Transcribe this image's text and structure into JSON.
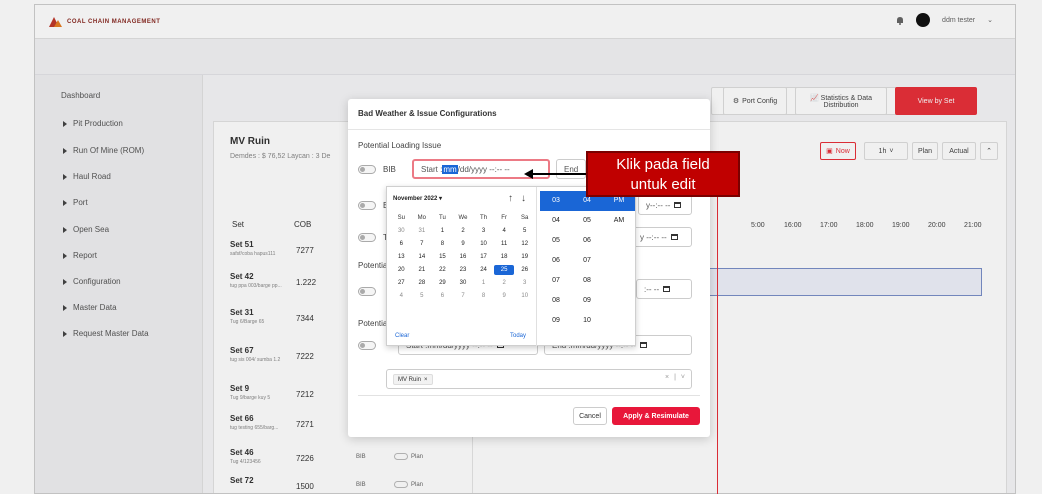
{
  "topbar": {
    "brand": "COAL CHAIN MANAGEMENT",
    "user_name": "ddm tester"
  },
  "sidebar": {
    "title": "Dashboard",
    "items": [
      {
        "label": "Pit Production"
      },
      {
        "label": "Run Of Mine (ROM)"
      },
      {
        "label": "Haul Road"
      },
      {
        "label": "Port"
      },
      {
        "label": "Open Sea"
      },
      {
        "label": "Report"
      },
      {
        "label": "Configuration"
      },
      {
        "label": "Master Data"
      },
      {
        "label": "Request Master Data"
      }
    ]
  },
  "main": {
    "title": "MV Ruin",
    "subtitle": "Demdes : $ 76,52   Laycan : 3 De",
    "buttons": {
      "port_config": "Port Config",
      "stats_line1": "Statistics & Data",
      "stats_line2": "Distribution",
      "view_by_set": "View by Set"
    },
    "controls": {
      "now": "Now",
      "interval": "1h",
      "plan": "Plan",
      "actual": "Actual"
    },
    "columns": {
      "set": "Set",
      "cob": "COB"
    },
    "hours": [
      "5:00",
      "16:00",
      "17:00",
      "18:00",
      "19:00",
      "20:00",
      "21:00"
    ],
    "rows": [
      {
        "name": "Set 51",
        "sub": "safsf/coba hapus111",
        "cob": "7277",
        "bib": "",
        "plan": ""
      },
      {
        "name": "Set 42",
        "sub": "tug ppa 003/barge pp...",
        "cob": "1.222",
        "bib": "",
        "plan": ""
      },
      {
        "name": "Set 31",
        "sub": "Tug 6/Barge 65",
        "cob": "7344",
        "bib": "",
        "plan": ""
      },
      {
        "name": "Set 67",
        "sub": "tug sis 004/ sumba 1.2",
        "cob": "7222",
        "bib": "",
        "plan": ""
      },
      {
        "name": "Set 9",
        "sub": "Tug 9/barge kuy 5",
        "cob": "7212",
        "bib": "",
        "plan": ""
      },
      {
        "name": "Set 66",
        "sub": "tug testing 655/barg...",
        "cob": "7271",
        "bib": "",
        "plan": ""
      },
      {
        "name": "Set 46",
        "sub": "Tug 4/123456",
        "cob": "7226",
        "bib": "BIB",
        "plan": "Plan"
      },
      {
        "name": "Set 72",
        "sub": "",
        "cob": "1500",
        "bib": "BIB",
        "plan": "Plan"
      }
    ]
  },
  "modal": {
    "title": "Bad Weather & Issue Configurations",
    "section_loading": "Potential Loading Issue",
    "section_sailing": "Potential Saili",
    "section_discharge": "Potential Disc",
    "labels": {
      "bib": "BIB",
      "bir": "BIR",
      "tia": "TIA",
      "s": "S"
    },
    "start_prefix": "Start :",
    "start_mm": "mm",
    "start_rest": "/dd/yyyy --:-- --",
    "end_prefix": "End",
    "partial_right_1": "y--:-- --",
    "partial_right_2": "y --:-- --",
    "partial_right_3": ":-- --",
    "disc_start": "Start :mm/dd/yyyy --:-- --",
    "disc_end": "End :mm/dd/yyyy --:-- --",
    "ship_chip": "MV Ruin",
    "cancel": "Cancel",
    "apply": "Apply & Resimulate"
  },
  "picker": {
    "month": "November 2022 ▾",
    "weekdays": [
      "Su",
      "Mo",
      "Tu",
      "We",
      "Th",
      "Fr",
      "Sa"
    ],
    "days": [
      [
        "30",
        "31",
        "1",
        "2",
        "3",
        "4",
        "5"
      ],
      [
        "6",
        "7",
        "8",
        "9",
        "10",
        "11",
        "12"
      ],
      [
        "13",
        "14",
        "15",
        "16",
        "17",
        "18",
        "19"
      ],
      [
        "20",
        "21",
        "22",
        "23",
        "24",
        "25",
        "26"
      ],
      [
        "27",
        "28",
        "29",
        "30",
        "1",
        "2",
        "3"
      ],
      [
        "4",
        "5",
        "6",
        "7",
        "8",
        "9",
        "10"
      ]
    ],
    "selected_day": "25",
    "clear": "Clear",
    "today": "Today",
    "hours": [
      "03",
      "04",
      "05",
      "06",
      "07",
      "08",
      "09"
    ],
    "minutes": [
      "04",
      "05",
      "06",
      "07",
      "08",
      "09",
      "10"
    ],
    "ampm": [
      "PM",
      "AM"
    ]
  },
  "callout": {
    "line1": "Klik pada field",
    "line2": "untuk edit"
  },
  "colors": {
    "accent_red": "#e8303a",
    "callout_red": "#c00000",
    "selection_blue": "#1a66d6"
  }
}
